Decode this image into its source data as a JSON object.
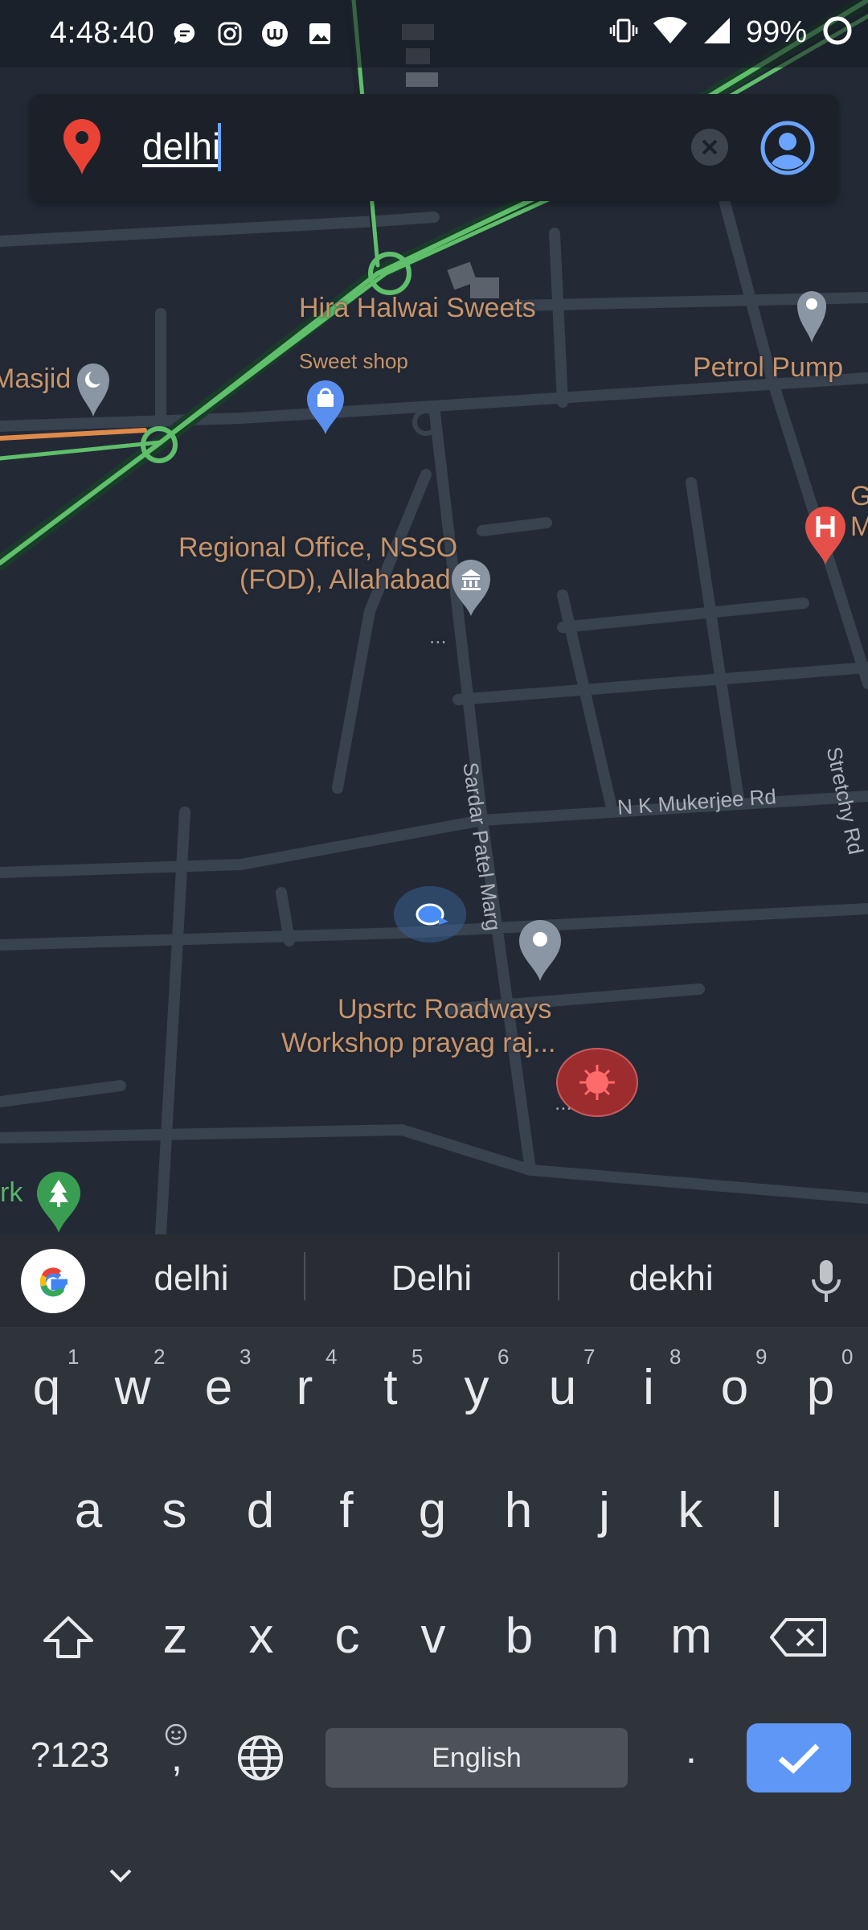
{
  "status_bar": {
    "time": "4:48:40",
    "battery": "99%",
    "left_icons": [
      "message-icon",
      "instagram-icon",
      "upstox-icon",
      "gallery-icon"
    ],
    "right_icons": [
      "vibrate-icon",
      "wifi-icon",
      "signal-icon",
      "battery-ring-icon"
    ]
  },
  "search": {
    "value": "delhi",
    "pin_color": "#ea4335",
    "profile_color": "#6aa4ff"
  },
  "map": {
    "labels": {
      "hira": "Hira Halwai Sweets",
      "sweet_shop": "Sweet shop",
      "petrol": "Petrol Pump",
      "masjid": "Masjid",
      "regional_line1": "Regional Office, NSSO",
      "regional_line2": "(FOD), Allahabad",
      "regional_more": "...",
      "upsrtc_line1": "Upsrtc Roadways",
      "upsrtc_line2": "Workshop prayag raj...",
      "upsrtc_more": "...",
      "park_fragment": "rk",
      "hospital_fragment_1": "G",
      "hospital_fragment_2": "M"
    },
    "streets": {
      "sardar": "Sardar Patel Marg",
      "nk": "N K Mukerjee Rd",
      "stretchy": "Stretchy Rd"
    }
  },
  "keyboard": {
    "suggestions": [
      "delhi",
      "Delhi",
      "dekhi"
    ],
    "row1": [
      "q",
      "w",
      "e",
      "r",
      "t",
      "y",
      "u",
      "i",
      "o",
      "p"
    ],
    "row1_hints": [
      "1",
      "2",
      "3",
      "4",
      "5",
      "6",
      "7",
      "8",
      "9",
      "0"
    ],
    "row2": [
      "a",
      "s",
      "d",
      "f",
      "g",
      "h",
      "j",
      "k",
      "l"
    ],
    "row3": [
      "z",
      "x",
      "c",
      "v",
      "b",
      "n",
      "m"
    ],
    "symbols": "?123",
    "comma": ",",
    "space": "English",
    "period": ".",
    "enter_color": "#5e97f6"
  }
}
